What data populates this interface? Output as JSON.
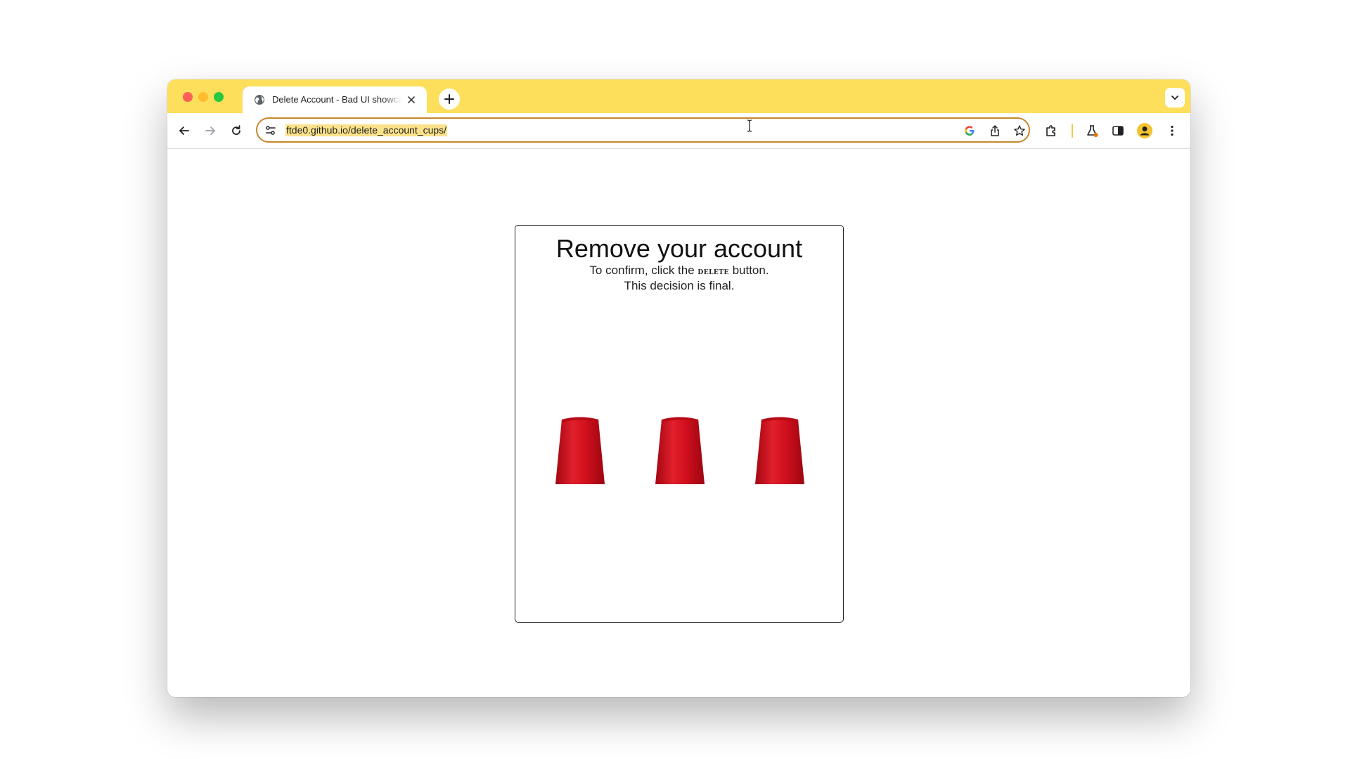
{
  "browser": {
    "tab": {
      "title": "Delete Account - Bad UI showcase"
    },
    "address_bar": {
      "url": "ftde0.github.io/delete_account_cups/"
    }
  },
  "page": {
    "title": "Remove your account",
    "instruction_before": "To confirm, click the ",
    "instruction_keyword": "delete",
    "instruction_after": " button.",
    "final_note": "This decision is final.",
    "cups": [
      {
        "label": "cup-1"
      },
      {
        "label": "cup-2"
      },
      {
        "label": "cup-3"
      }
    ]
  },
  "colors": {
    "titlebar": "#fddf5c",
    "omnibox_border": "#c8862a",
    "cup_red": "#d3101e"
  },
  "icons": [
    "globe-icon",
    "close-icon",
    "plus-icon",
    "chevron-down-icon",
    "back-arrow-icon",
    "forward-arrow-icon",
    "reload-icon",
    "tune-icon",
    "google-icon",
    "share-icon",
    "star-icon",
    "extensions-icon",
    "labs-flask-icon",
    "side-panel-icon",
    "profile-avatar-icon",
    "kebab-menu-icon",
    "text-cursor-icon"
  ]
}
